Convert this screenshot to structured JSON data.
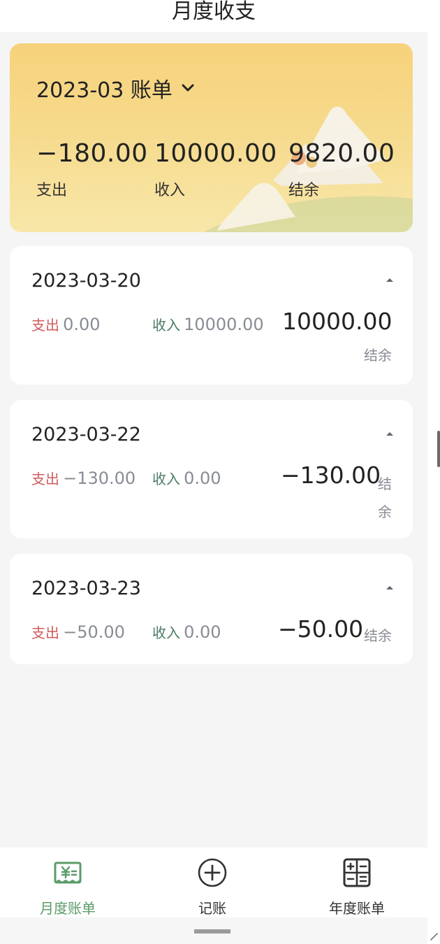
{
  "header": {
    "title": "月度收支"
  },
  "summary": {
    "month_label": "2023-03 账单",
    "expense_value": "−180.00",
    "expense_label": "支出",
    "income_value": "10000.00",
    "income_label": "收入",
    "balance_value": "9820.00",
    "balance_label": "结余"
  },
  "days": [
    {
      "date": "2023-03-20",
      "expense_label": "支出",
      "expense_value": "0.00",
      "income_label": "收入",
      "income_value": "10000.00",
      "balance_value": "10000.00",
      "balance_label": "结余"
    },
    {
      "date": "2023-03-22",
      "expense_label": "支出",
      "expense_value": "−130.00",
      "income_label": "收入",
      "income_value": "0.00",
      "balance_value": "−130.00",
      "balance_label": "结余"
    },
    {
      "date": "2023-03-23",
      "expense_label": "支出",
      "expense_value": "−50.00",
      "income_label": "收入",
      "income_value": "0.00",
      "balance_value": "−50.00",
      "balance_label": "结余"
    }
  ],
  "tabs": [
    {
      "label": "月度账单",
      "icon": "bill-icon",
      "active": true
    },
    {
      "label": "记账",
      "icon": "plus-circle-icon",
      "active": false
    },
    {
      "label": "年度账单",
      "icon": "calculator-icon",
      "active": false
    }
  ],
  "colors": {
    "accent_green": "#5c9c6a",
    "expense_red": "#d05c5c",
    "income_green": "#4b7c65",
    "summary_yellow": "#f7d27b"
  }
}
